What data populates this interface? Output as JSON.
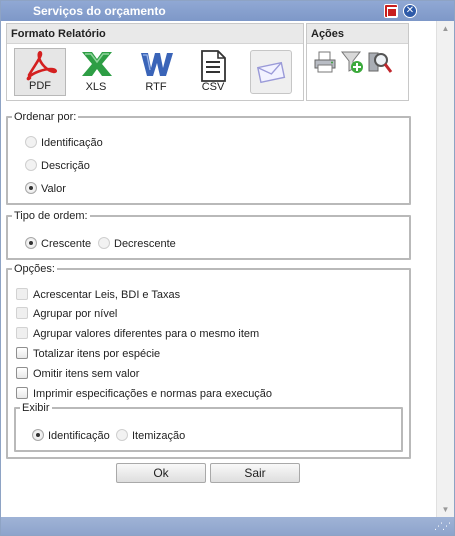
{
  "window": {
    "title": "Serviços do orçamento"
  },
  "formato": {
    "header": "Formato Relatório",
    "items": [
      {
        "label": "PDF",
        "icon": "pdf-icon",
        "selected": true
      },
      {
        "label": "XLS",
        "icon": "excel-icon"
      },
      {
        "label": "RTF",
        "icon": "word-icon"
      },
      {
        "label": "CSV",
        "icon": "csv-document-icon"
      },
      {
        "label": "",
        "icon": "email-envelope-icon"
      }
    ]
  },
  "acoes": {
    "header": "Ações",
    "items": [
      {
        "icon": "printer-icon"
      },
      {
        "icon": "add-filter-icon"
      },
      {
        "icon": "preview-search-icon"
      }
    ]
  },
  "ordenar": {
    "legend": "Ordenar por:",
    "options": [
      {
        "label": "Identificação",
        "checked": false
      },
      {
        "label": "Descrição",
        "checked": false
      },
      {
        "label": "Valor",
        "checked": true
      }
    ]
  },
  "tipo_ordem": {
    "legend": "Tipo de ordem:",
    "options": [
      {
        "label": "Crescente",
        "checked": true
      },
      {
        "label": "Decrescente",
        "checked": false
      }
    ]
  },
  "opcoes": {
    "legend": "Opções:",
    "items": [
      {
        "label": "Acrescentar Leis, BDI e Taxas",
        "enabled": false
      },
      {
        "label": "Agrupar por nível",
        "enabled": false
      },
      {
        "label": "Agrupar valores diferentes para o mesmo item",
        "enabled": false
      },
      {
        "label": "Totalizar itens por espécie",
        "enabled": true
      },
      {
        "label": "Omitir itens sem valor",
        "enabled": true
      },
      {
        "label": "Imprimir especificações e normas para execução",
        "enabled": true
      }
    ],
    "exibir": {
      "legend": "Exibir",
      "options": [
        {
          "label": "Identificação",
          "checked": true
        },
        {
          "label": "Itemização",
          "checked": false
        }
      ]
    }
  },
  "buttons": {
    "ok": "Ok",
    "sair": "Sair"
  },
  "colors": {
    "titlebar": "#8aa2d0",
    "pdf_red": "#d42020",
    "xls_green": "#2e9e45",
    "rtf_blue": "#3a64b8"
  }
}
